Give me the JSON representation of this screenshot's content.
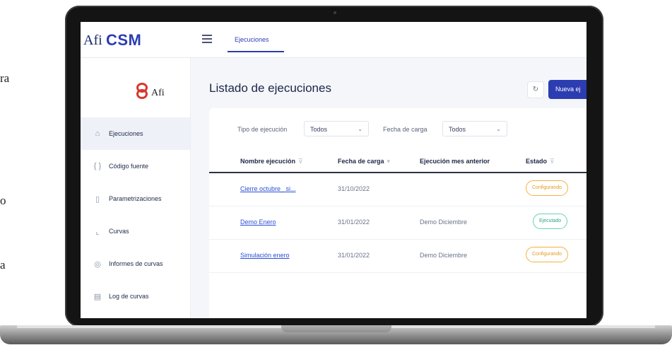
{
  "page_fragments": [
    "ra",
    "o",
    "a"
  ],
  "app": {
    "logo_prefix": "Afi",
    "logo_name": "CSM",
    "brand_text": "Afi"
  },
  "header": {
    "active_tab": "Ejecuciones"
  },
  "sidebar": {
    "items": [
      {
        "icon": "home-icon",
        "glyph": "⌂",
        "label": "Ejecuciones",
        "active": true
      },
      {
        "icon": "code-icon",
        "glyph": "{ }",
        "label": "Código fuente",
        "active": false
      },
      {
        "icon": "document-icon",
        "glyph": "▯",
        "label": "Parametrizaciones",
        "active": false
      },
      {
        "icon": "chart-icon",
        "glyph": "⌞",
        "label": "Curvas",
        "active": false
      },
      {
        "icon": "report-icon",
        "glyph": "◎",
        "label": "Informes de curvas",
        "active": false
      },
      {
        "icon": "log-icon",
        "glyph": "▤",
        "label": "Log de curvas",
        "active": false
      }
    ]
  },
  "main": {
    "title": "Listado de ejecuciones",
    "refresh_glyph": "↻",
    "new_button": "Nueva ej"
  },
  "filters": {
    "tipo_label": "Tipo de ejecución",
    "tipo_value": "Todos",
    "fecha_label": "Fecha de carga",
    "fecha_value": "Todos"
  },
  "table": {
    "columns": [
      "Nombre ejecución",
      "Fecha de carga",
      "Ejecución mes anterior",
      "Estado"
    ],
    "rows": [
      {
        "name": "Cierre octubre_ si...",
        "date": "31/10/2022",
        "previous": "",
        "status": "Configurando"
      },
      {
        "name": "Demo Enero",
        "date": "31/01/2022",
        "previous": "Demo Diciembre",
        "status": "Ejecutado"
      },
      {
        "name": "Simulación enero",
        "date": "31/01/2022",
        "previous": "Demo Diciembre",
        "status": "Configurando"
      }
    ]
  },
  "colors": {
    "accent": "#2b3db1",
    "configurando": "#e39a1b",
    "ejecutado": "#2aa580",
    "brand_red": "#d9362b"
  }
}
